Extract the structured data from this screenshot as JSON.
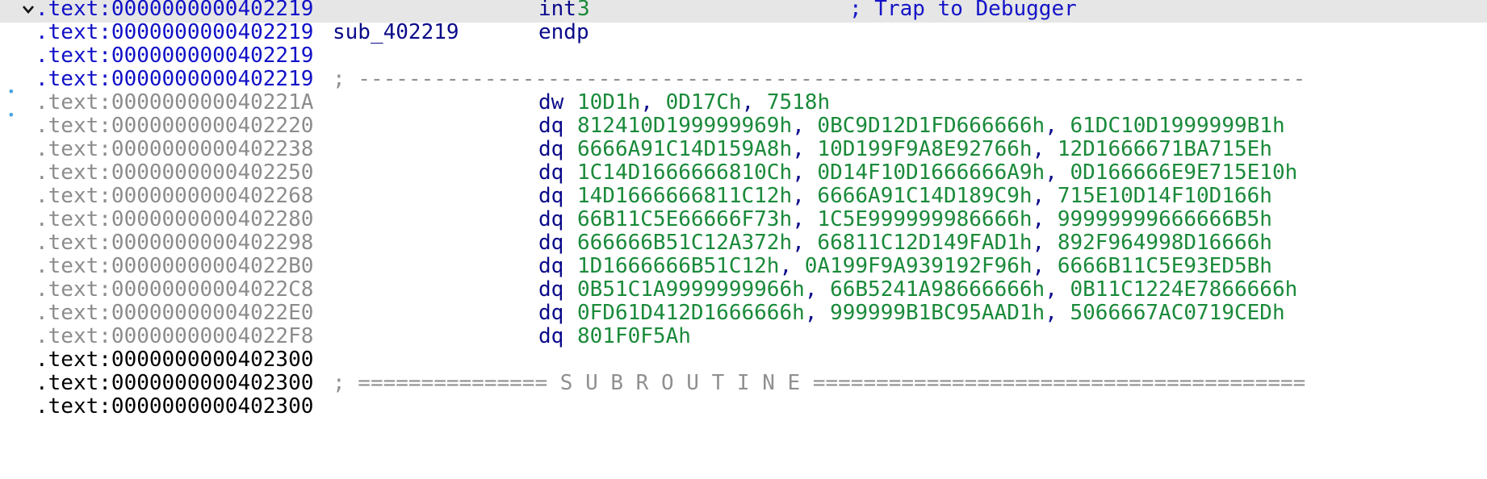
{
  "colors": {
    "code_address": "#1010c8",
    "data_address": "#8c8c8c",
    "mnemonic": "#0a0a8a",
    "operand": "#1a8a3a",
    "comment": "#1414c8",
    "highlight": "#e6e6e6",
    "marker": "#4aa3df"
  },
  "lines": [
    {
      "addr": ".text:0000000000402219",
      "mnem": "int",
      "op": "3",
      "cmt": "; Trap to Debugger"
    },
    {
      "addr": ".text:0000000000402219",
      "label": "sub_402219",
      "mnem": "endp"
    },
    {
      "addr": ".text:0000000000402219"
    },
    {
      "addr": ".text:0000000000402219",
      "divider": "; ---------------------------------------------------------------------------"
    },
    {
      "addr": ".text:000000000040221A",
      "mnem": "dw",
      "ops": [
        "10D1h",
        "0D17Ch",
        "7518h"
      ]
    },
    {
      "addr": ".text:0000000000402220",
      "mnem": "dq",
      "ops": [
        "812410D199999969h",
        "0BC9D12D1FD666666h",
        "61DC10D1999999B1h"
      ]
    },
    {
      "addr": ".text:0000000000402238",
      "mnem": "dq",
      "ops": [
        "6666A91C14D159A8h",
        "10D199F9A8E92766h",
        "12D1666671BA715Eh"
      ]
    },
    {
      "addr": ".text:0000000000402250",
      "mnem": "dq",
      "ops": [
        "1C14D1666666810Ch",
        "0D14F10D1666666A9h",
        "0D166666E9E715E10h"
      ]
    },
    {
      "addr": ".text:0000000000402268",
      "mnem": "dq",
      "ops": [
        "14D1666666811C12h",
        "6666A91C14D189C9h",
        "715E10D14F10D166h"
      ]
    },
    {
      "addr": ".text:0000000000402280",
      "mnem": "dq",
      "ops": [
        "66B11C5E66666F73h",
        "1C5E999999986666h",
        "99999999666666B5h"
      ]
    },
    {
      "addr": ".text:0000000000402298",
      "mnem": "dq",
      "ops": [
        "666666B51C12A372h",
        "66811C12D149FAD1h",
        "892F964998D16666h"
      ]
    },
    {
      "addr": ".text:00000000004022B0",
      "mnem": "dq",
      "ops": [
        "1D1666666B51C12h",
        "0A199F9A939192F96h",
        "6666B11C5E93ED5Bh"
      ]
    },
    {
      "addr": ".text:00000000004022C8",
      "mnem": "dq",
      "ops": [
        "0B51C1A9999999966h",
        "66B5241A98666666h",
        "0B11C1224E7866666h"
      ]
    },
    {
      "addr": ".text:00000000004022E0",
      "mnem": "dq",
      "ops": [
        "0FD61D412D1666666h",
        "999999B1BC95AAD1h",
        "5066667AC0719CEDh"
      ]
    },
    {
      "addr": ".text:00000000004022F8",
      "mnem": "dq",
      "ops": [
        "801F0F5Ah"
      ]
    },
    {
      "addr": ".text:0000000000402300"
    },
    {
      "addr": ".text:0000000000402300",
      "divider": "; =============== S U B R O U T I N E ======================================="
    },
    {
      "addr": ".text:0000000000402300"
    }
  ]
}
